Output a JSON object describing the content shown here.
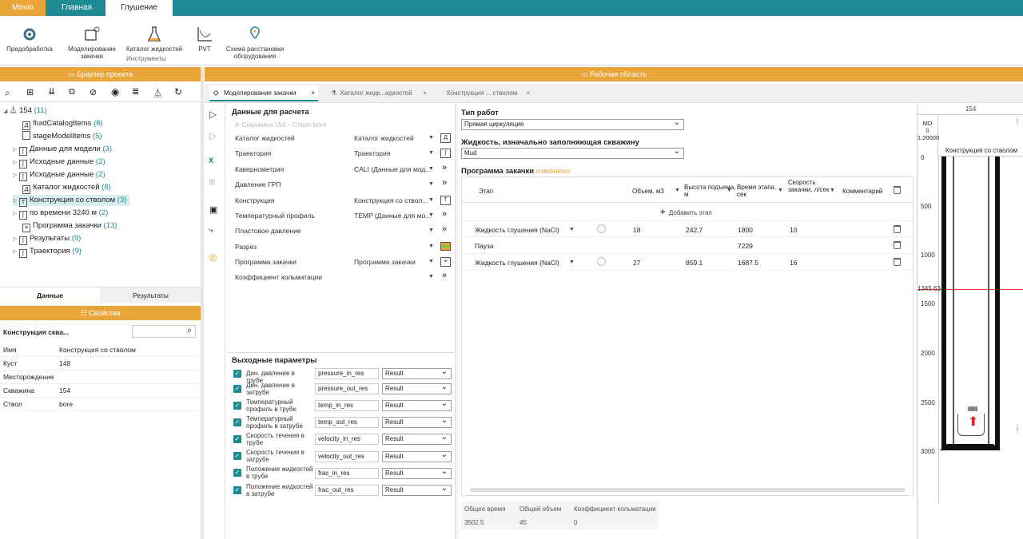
{
  "top_tabs": [
    "Меню",
    "Главная",
    "Глушение"
  ],
  "ribbon": {
    "items": [
      "Предобработка",
      "Моделирование закачки",
      "Каталог жидкостей",
      "PVT",
      "Схема расстановки оборудования"
    ],
    "group": "Инструменты"
  },
  "left": {
    "browser_title": "Браузер проекта",
    "tree": [
      {
        "label": "154",
        "count": "(11)"
      },
      {
        "label": "fluidCatalogItems",
        "count": "(8)"
      },
      {
        "label": "stageModelItems",
        "count": "(5)"
      },
      {
        "label": "Данные для модели",
        "count": "(3)"
      },
      {
        "label": "Исходные данные",
        "count": "(2)"
      },
      {
        "label": "Исходные данные",
        "count": "(2)"
      },
      {
        "label": "Каталог жидкостей",
        "count": "(8)"
      },
      {
        "label": "Конструкция со стволом",
        "count": "(3)"
      },
      {
        "label": "по времени 3240 м",
        "count": "(2)"
      },
      {
        "label": "Программа закачки",
        "count": "(13)"
      },
      {
        "label": "Результаты",
        "count": "(9)"
      },
      {
        "label": "Траектория",
        "count": "(9)"
      }
    ],
    "tabs": [
      "Данные",
      "Результаты"
    ],
    "props_title": "Свойства",
    "props_object": "Конструкция сква...",
    "props": [
      {
        "k": "Имя",
        "v": "Конструкция со стволом"
      },
      {
        "k": "Куст",
        "v": "148"
      },
      {
        "k": "Месторождение",
        "v": ""
      },
      {
        "k": "Скважина",
        "v": "154"
      },
      {
        "k": "Ствол",
        "v": "bore"
      }
    ]
  },
  "work": {
    "title": "Рабочая область",
    "tabs": [
      "Моделирование закачки",
      "Каталог жидк...идкостей",
      "Конструкция ... стволом"
    ],
    "calc_title": "Данные для расчета",
    "well": "Скважина 154 - Ствол bore",
    "inputs": [
      {
        "k": "Каталог жидкостей",
        "v": "Каталог жидкостей"
      },
      {
        "k": "Траектория",
        "v": "Траектория"
      },
      {
        "k": "Кавернометрия",
        "v": "CALI (Данные для мод..."
      },
      {
        "k": "Давление ГРП",
        "v": ""
      },
      {
        "k": "Конструкция",
        "v": "Конструкция со ствол..."
      },
      {
        "k": "Температурный профиль",
        "v": "TEMP (Данные для мо..."
      },
      {
        "k": "Пластовое давление",
        "v": ""
      },
      {
        "k": "Разрез",
        "v": ""
      },
      {
        "k": "Программа закачки",
        "v": "Программа закачки"
      },
      {
        "k": "Коэффициент кольматации",
        "v": ""
      }
    ],
    "out_title": "Выходные параметры",
    "outputs": [
      {
        "k": "Дин. давление в трубе",
        "n": "pressure_in_res",
        "r": "Result"
      },
      {
        "k": "Дин. давление в затрубе",
        "n": "pressure_out_res",
        "r": "Result"
      },
      {
        "k": "Температурный профиль в трубе",
        "n": "temp_in_res",
        "r": "Result"
      },
      {
        "k": "Температурный профиль в затрубе",
        "n": "temp_out_res",
        "r": "Result"
      },
      {
        "k": "Скорость течения в трубе",
        "n": "velocity_in_res",
        "r": "Result"
      },
      {
        "k": "Скорость течения в затрубе",
        "n": "velocity_out_res",
        "r": "Result"
      },
      {
        "k": "Положение жидкостей в трубе",
        "n": "frac_in_res",
        "r": "Result"
      },
      {
        "k": "Положение жидкостей в затрубе",
        "n": "frac_out_res",
        "r": "Result"
      }
    ],
    "work_type_label": "Тип работ",
    "work_type": "Прямая циркуляция",
    "fluid_label": "Жидкость, изначально заполняющая скважину",
    "fluid": "Mud",
    "prog_label": "Программа закачки",
    "prog_changed": "изменено",
    "cols": [
      "Этап",
      "Объем, м3",
      "Высота подъема, м",
      "Время этапа, сек",
      "Скорость закачки, л/сек",
      "Комментарий"
    ],
    "add_stage": "Добавить этап",
    "rows": [
      {
        "stage": "Жидкость глушения (NaCl)",
        "vol": "18",
        "h": "242.7",
        "t": "1800",
        "q": "10"
      },
      {
        "stage": "Пауза",
        "vol": "",
        "h": "",
        "t": "7229",
        "q": ""
      },
      {
        "stage": "Жидкость глушения (NaCl)",
        "vol": "27",
        "h": "859.1",
        "t": "1687.5",
        "q": "16"
      }
    ],
    "totals": [
      {
        "k": "Общее время",
        "v": "3502.5"
      },
      {
        "k": "Общий объем",
        "v": "45"
      },
      {
        "k": "Коэффициент кольматации",
        "v": "0"
      }
    ]
  },
  "well": {
    "id": "154",
    "md": "MD",
    "md0": "0",
    "scale": "1:20000",
    "title": "Конструкция со стволом",
    "ticks": [
      "0",
      "500",
      "1000",
      "1345.63",
      "1500",
      "2000",
      "2500",
      "3000"
    ]
  }
}
